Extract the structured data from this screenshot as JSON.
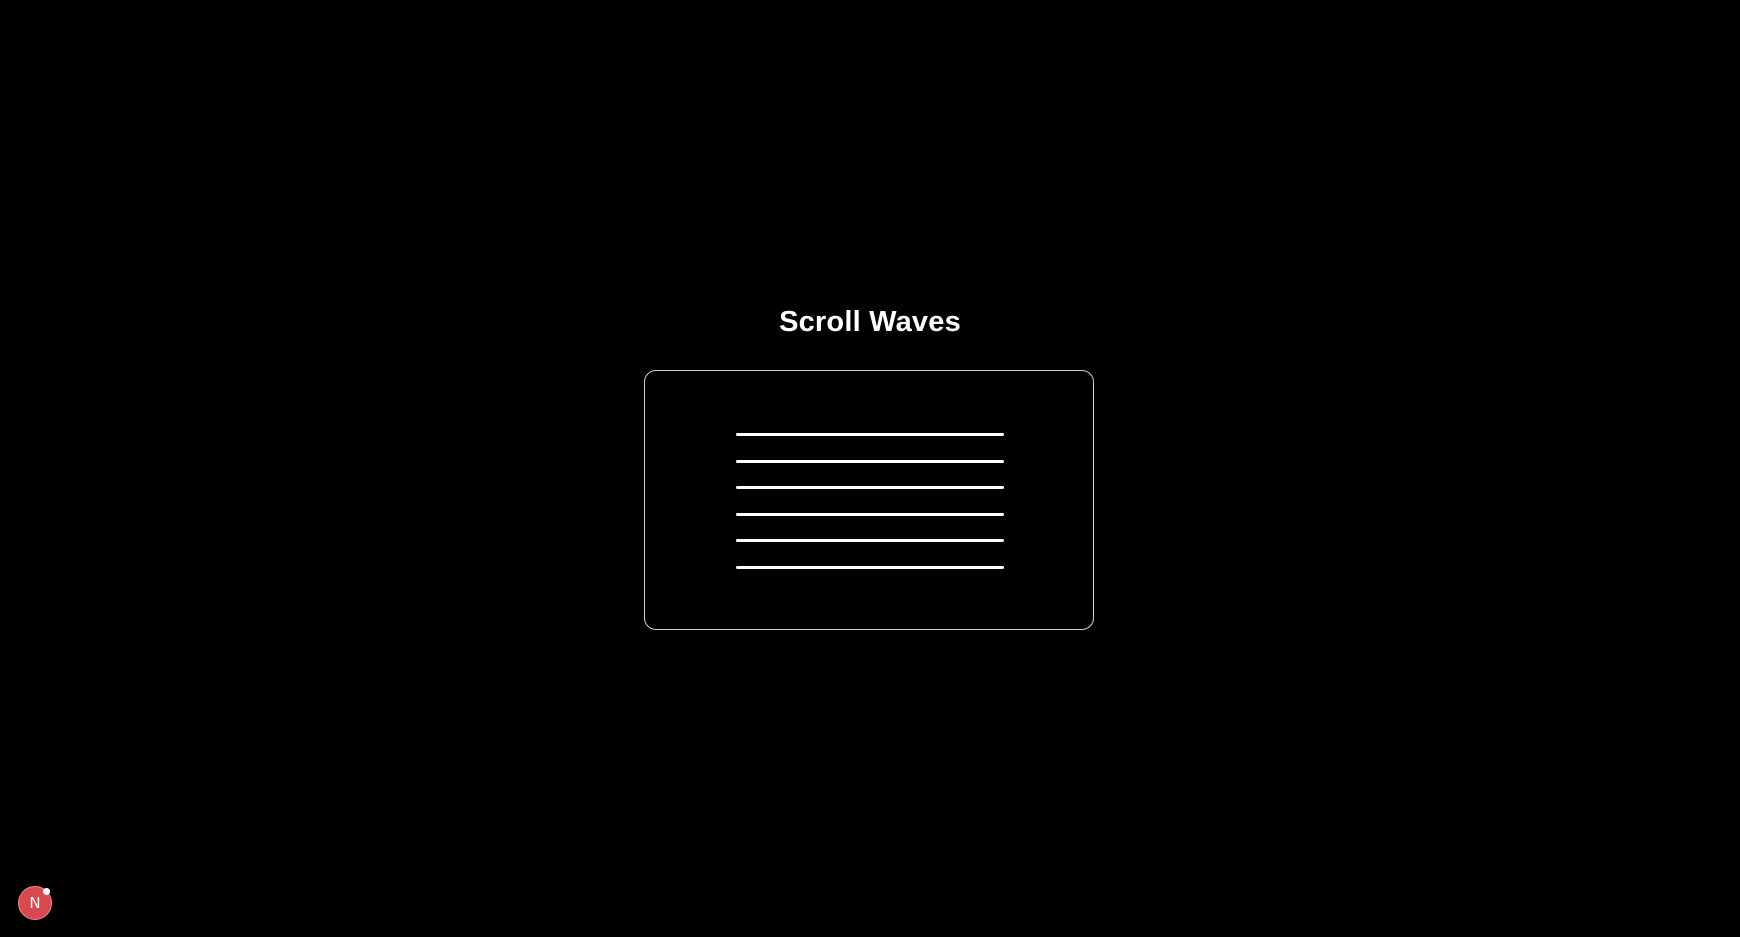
{
  "page": {
    "title": "Scroll Waves",
    "background_color": "#000000"
  },
  "waves": {
    "line_color": "#ffffff",
    "border_color": "#cfcfcf",
    "lines": [
      {
        "name": "wave-line-1"
      },
      {
        "name": "wave-line-2"
      },
      {
        "name": "wave-line-3"
      },
      {
        "name": "wave-line-4"
      },
      {
        "name": "wave-line-5"
      },
      {
        "name": "wave-line-6"
      }
    ]
  },
  "dev_indicator": {
    "letter": "N",
    "color": "#d9474f",
    "icon": "nextjs-dev-tools-icon"
  }
}
